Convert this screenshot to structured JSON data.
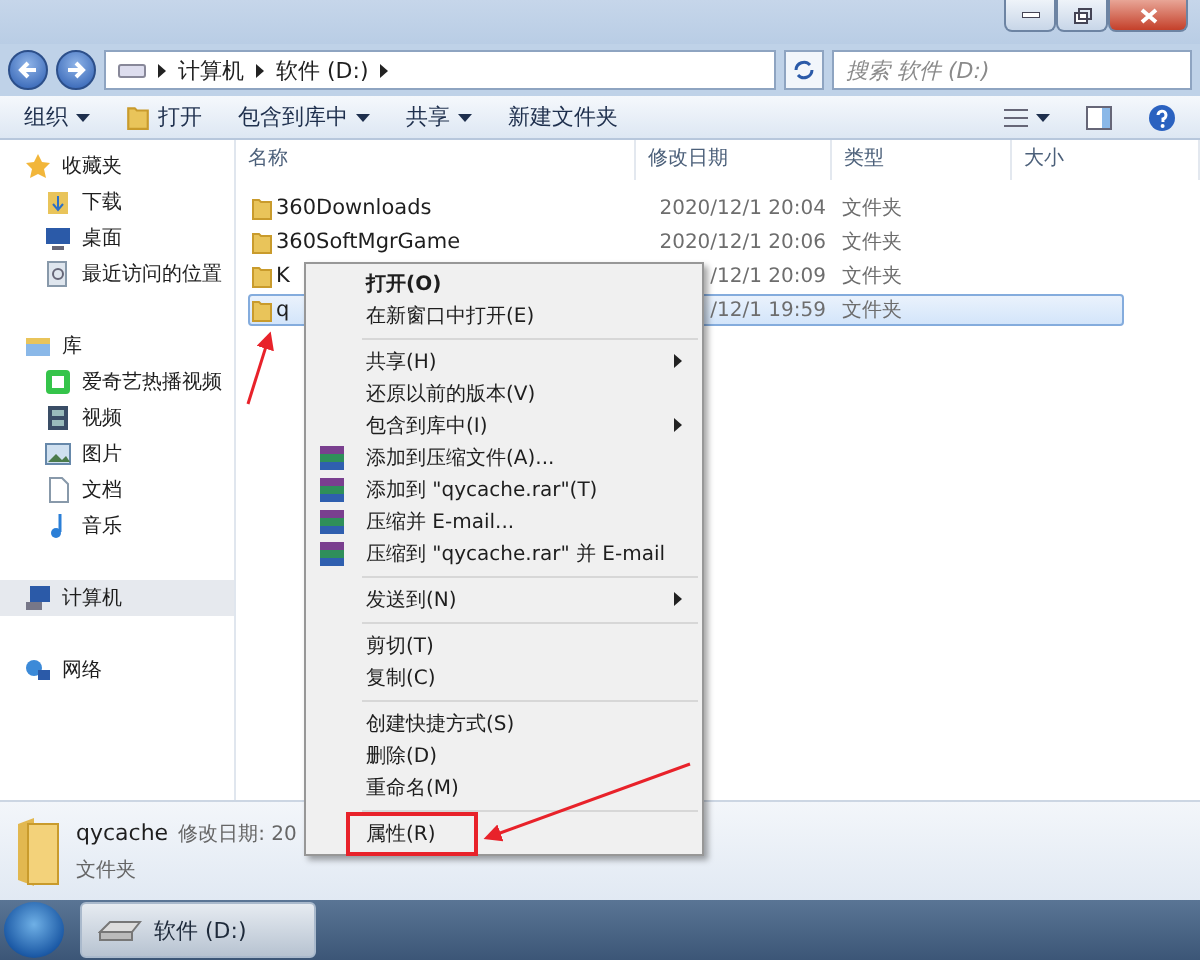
{
  "address": {
    "crumbs": [
      "计算机",
      "软件 (D:)"
    ]
  },
  "search": {
    "placeholder": "搜索 软件 (D:)"
  },
  "toolbar": {
    "items": [
      {
        "label": "组织",
        "dropdown": true
      },
      {
        "label": "打开",
        "dropdown": false
      },
      {
        "label": "包含到库中",
        "dropdown": true
      },
      {
        "label": "共享",
        "dropdown": true
      },
      {
        "label": "新建文件夹",
        "dropdown": false
      }
    ]
  },
  "sidebar": {
    "groups": [
      {
        "label": "收藏夹",
        "selected": false,
        "children": [
          {
            "label": "下载"
          },
          {
            "label": "桌面"
          },
          {
            "label": "最近访问的位置"
          }
        ]
      },
      {
        "label": "库",
        "selected": false,
        "children": [
          {
            "label": "爱奇艺热播视频"
          },
          {
            "label": "视频"
          },
          {
            "label": "图片"
          },
          {
            "label": "文档"
          },
          {
            "label": "音乐"
          }
        ]
      },
      {
        "label": "计算机",
        "selected": true
      },
      {
        "label": "网络",
        "selected": false
      }
    ]
  },
  "table": {
    "columns": [
      "名称",
      "修改日期",
      "类型",
      "大小"
    ],
    "rows": [
      {
        "name": "360Downloads",
        "date": "2020/12/1 20:04",
        "type": "文件夹",
        "selected": false
      },
      {
        "name": "360SoftMgrGame",
        "date": "2020/12/1 20:06",
        "type": "文件夹",
        "selected": false
      },
      {
        "name": "K",
        "date": "/12/1 20:09",
        "type": "文件夹",
        "selected": false
      },
      {
        "name": "q",
        "date": "/12/1 19:59",
        "type": "文件夹",
        "selected": true
      }
    ]
  },
  "context_menu": {
    "items": [
      {
        "kind": "item",
        "label": "打开(O)",
        "bold": true,
        "submenu": false,
        "icon": false,
        "highlighted": false
      },
      {
        "kind": "item",
        "label": "在新窗口中打开(E)",
        "bold": false,
        "submenu": false,
        "icon": false,
        "highlighted": false
      },
      {
        "kind": "separator"
      },
      {
        "kind": "item",
        "label": "共享(H)",
        "bold": false,
        "submenu": true,
        "icon": false,
        "highlighted": false
      },
      {
        "kind": "item",
        "label": "还原以前的版本(V)",
        "bold": false,
        "submenu": false,
        "icon": false,
        "highlighted": false
      },
      {
        "kind": "item",
        "label": "包含到库中(I)",
        "bold": false,
        "submenu": true,
        "icon": false,
        "highlighted": false
      },
      {
        "kind": "item",
        "label": "添加到压缩文件(A)...",
        "bold": false,
        "submenu": false,
        "icon": true,
        "highlighted": false
      },
      {
        "kind": "item",
        "label": "添加到 \"qycache.rar\"(T)",
        "bold": false,
        "submenu": false,
        "icon": true,
        "highlighted": false
      },
      {
        "kind": "item",
        "label": "压缩并 E-mail...",
        "bold": false,
        "submenu": false,
        "icon": true,
        "highlighted": false
      },
      {
        "kind": "item",
        "label": "压缩到 \"qycache.rar\" 并 E-mail",
        "bold": false,
        "submenu": false,
        "icon": true,
        "highlighted": false
      },
      {
        "kind": "separator"
      },
      {
        "kind": "item",
        "label": "发送到(N)",
        "bold": false,
        "submenu": true,
        "icon": false,
        "highlighted": false
      },
      {
        "kind": "separator"
      },
      {
        "kind": "item",
        "label": "剪切(T)",
        "bold": false,
        "submenu": false,
        "icon": false,
        "highlighted": false
      },
      {
        "kind": "item",
        "label": "复制(C)",
        "bold": false,
        "submenu": false,
        "icon": false,
        "highlighted": false
      },
      {
        "kind": "separator"
      },
      {
        "kind": "item",
        "label": "创建快捷方式(S)",
        "bold": false,
        "submenu": false,
        "icon": false,
        "highlighted": false
      },
      {
        "kind": "item",
        "label": "删除(D)",
        "bold": false,
        "submenu": false,
        "icon": false,
        "highlighted": false
      },
      {
        "kind": "item",
        "label": "重命名(M)",
        "bold": false,
        "submenu": false,
        "icon": false,
        "highlighted": false
      },
      {
        "kind": "separator"
      },
      {
        "kind": "item",
        "label": "属性(R)",
        "bold": false,
        "submenu": false,
        "icon": false,
        "highlighted": true
      }
    ]
  },
  "details": {
    "name": "qycache",
    "meta": "修改日期: 20",
    "type": "文件夹"
  },
  "taskbar": {
    "tasks": [
      {
        "label": "软件 (D:)",
        "selected": true
      }
    ]
  }
}
